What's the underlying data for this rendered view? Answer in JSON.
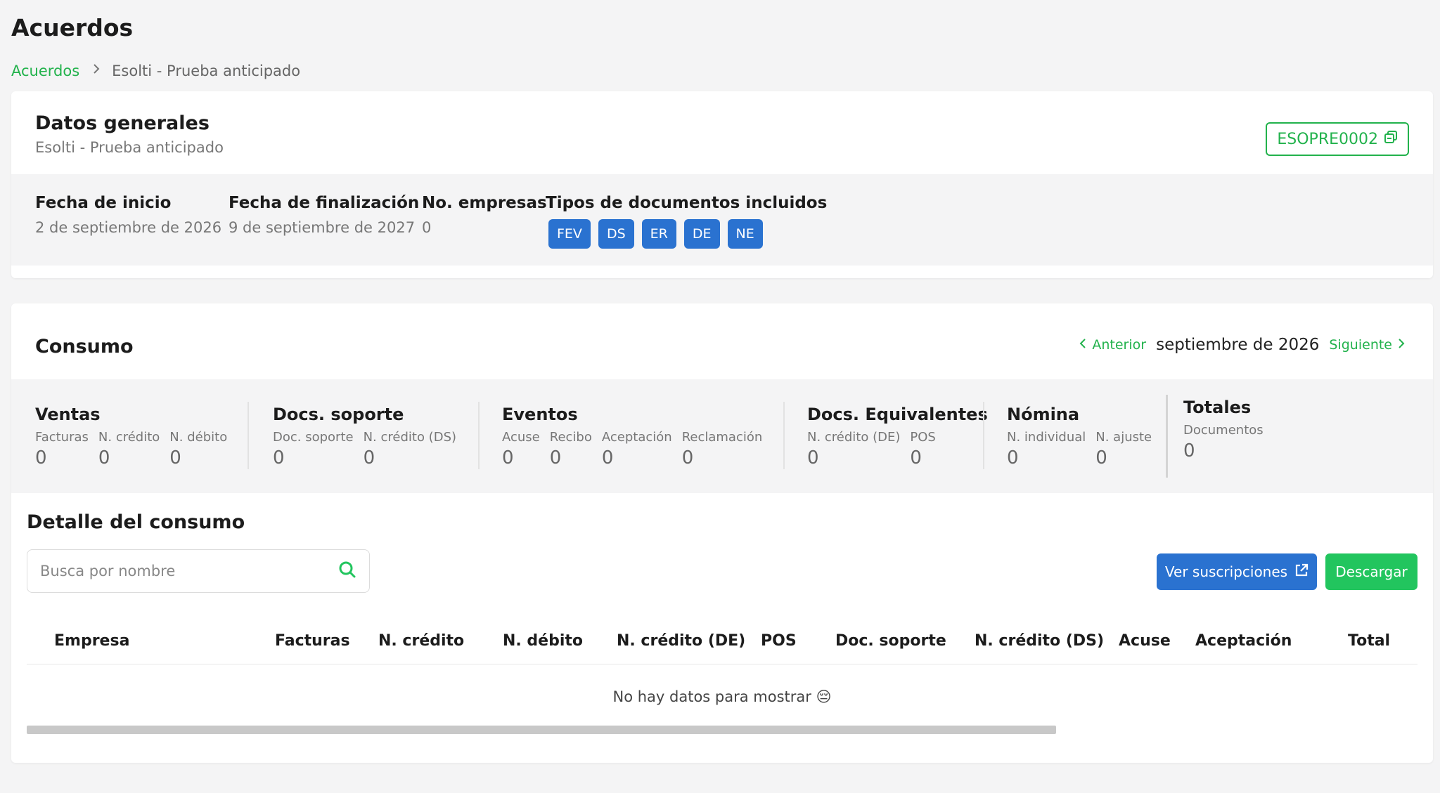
{
  "page": {
    "title": "Acuerdos"
  },
  "breadcrumb": {
    "root": "Acuerdos",
    "current": "Esolti - Prueba anticipado"
  },
  "general": {
    "title": "Datos generales",
    "subtitle": "Esolti - Prueba anticipado",
    "code": "ESOPRE0002",
    "fields": {
      "start_label": "Fecha de inicio",
      "start_value": "2 de septiembre de 2026",
      "end_label": "Fecha de finalización",
      "end_value": "9 de septiembre de 2027",
      "companies_label": "No. empresas",
      "companies_value": "0",
      "doc_types_label": "Tipos de documentos incluidos"
    },
    "doc_types": [
      "FEV",
      "DS",
      "ER",
      "DE",
      "NE"
    ]
  },
  "consumo": {
    "title": "Consumo",
    "prev_label": "Anterior",
    "next_label": "Siguiente",
    "month": "septiembre de 2026",
    "groups": [
      {
        "title": "Ventas",
        "cols": [
          {
            "label": "Facturas",
            "value": "0"
          },
          {
            "label": "N. crédito",
            "value": "0"
          },
          {
            "label": "N. débito",
            "value": "0"
          }
        ]
      },
      {
        "title": "Docs. soporte",
        "cols": [
          {
            "label": "Doc. soporte",
            "value": "0"
          },
          {
            "label": "N. crédito (DS)",
            "value": "0"
          }
        ]
      },
      {
        "title": "Eventos",
        "cols": [
          {
            "label": "Acuse",
            "value": "0"
          },
          {
            "label": "Recibo",
            "value": "0"
          },
          {
            "label": "Aceptación",
            "value": "0"
          },
          {
            "label": "Reclamación",
            "value": "0"
          }
        ]
      },
      {
        "title": "Docs. Equivalentes",
        "cols": [
          {
            "label": "N. crédito (DE)",
            "value": "0"
          },
          {
            "label": "POS",
            "value": "0"
          }
        ]
      },
      {
        "title": "Nómina",
        "cols": [
          {
            "label": "N. individual",
            "value": "0"
          },
          {
            "label": "N. ajuste",
            "value": "0"
          }
        ]
      }
    ],
    "totals": {
      "title": "Totales",
      "label": "Documentos",
      "value": "0"
    }
  },
  "detail": {
    "title": "Detalle del consumo",
    "search_placeholder": "Busca por nombre",
    "subscriptions_label": "Ver suscripciones",
    "download_label": "Descargar",
    "columns": [
      "Empresa",
      "Facturas",
      "N. crédito",
      "N. débito",
      "N. crédito (DE)",
      "POS",
      "Doc. soporte",
      "N. crédito (DS)",
      "Acuse",
      "Aceptación",
      "Total"
    ],
    "empty_message": "No hay datos para mostrar 😔"
  },
  "colors": {
    "accent_green": "#22b24c",
    "button_green": "#22c55e",
    "tag_blue": "#2a72d0"
  },
  "icons": {
    "code_button": "copy-icon",
    "search": "search-icon",
    "subscriptions": "external-link-icon",
    "prev": "chevron-left-icon",
    "next": "chevron-right-icon",
    "breadcrumb": "chevron-right-icon"
  }
}
